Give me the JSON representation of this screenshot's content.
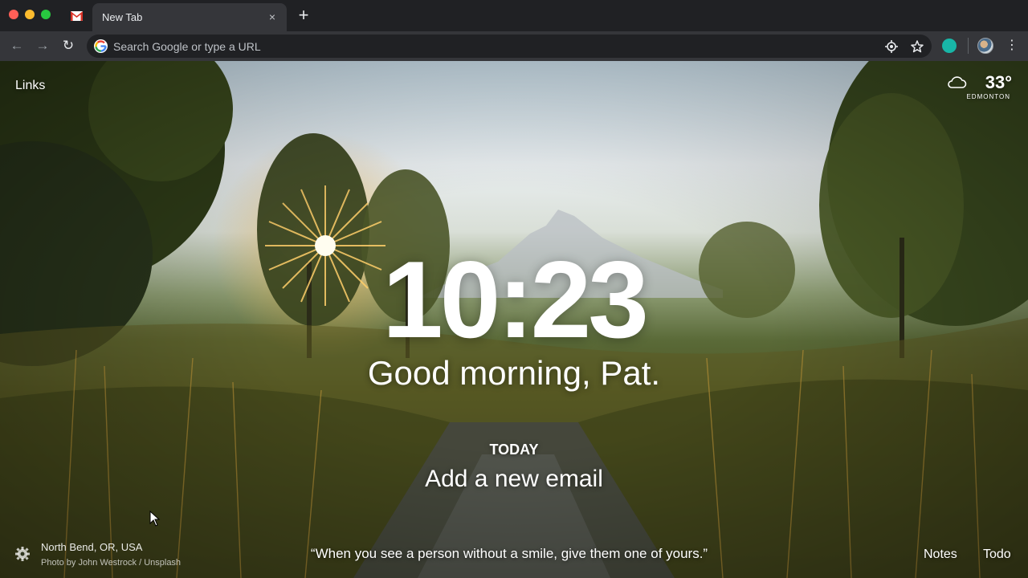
{
  "browser": {
    "tab": {
      "title": "New Tab",
      "close_glyph": "×"
    },
    "new_tab_glyph": "+",
    "nav": {
      "back": "←",
      "forward": "→",
      "reload": "↻"
    },
    "omnibox": {
      "placeholder": "Search Google or type a URL"
    },
    "menu_glyph": "⋮",
    "icons": [
      "gmail-icon",
      "google-icon",
      "location-target-icon",
      "star-icon",
      "extension-icon",
      "profile-avatar",
      "menu-icon"
    ]
  },
  "momentum": {
    "links_label": "Links",
    "weather": {
      "temperature": "33°",
      "location": "EDMONTON",
      "icon": "cloud-icon"
    },
    "clock": "10:23",
    "greeting": "Good morning, Pat.",
    "focus": {
      "label": "TODAY",
      "task": "Add a new email"
    },
    "background": {
      "location": "North Bend, OR, USA",
      "credit": "Photo by John Westrock / Unsplash"
    },
    "quote": "“When you see a person without a smile, give them one of yours.”",
    "bottom_right": {
      "notes": "Notes",
      "todo": "Todo"
    },
    "settings_icon": "gear-icon"
  },
  "colors": {
    "chrome_dark": "#202124",
    "chrome_toolbar": "#35363a",
    "extension_accent": "#18b6a7"
  }
}
